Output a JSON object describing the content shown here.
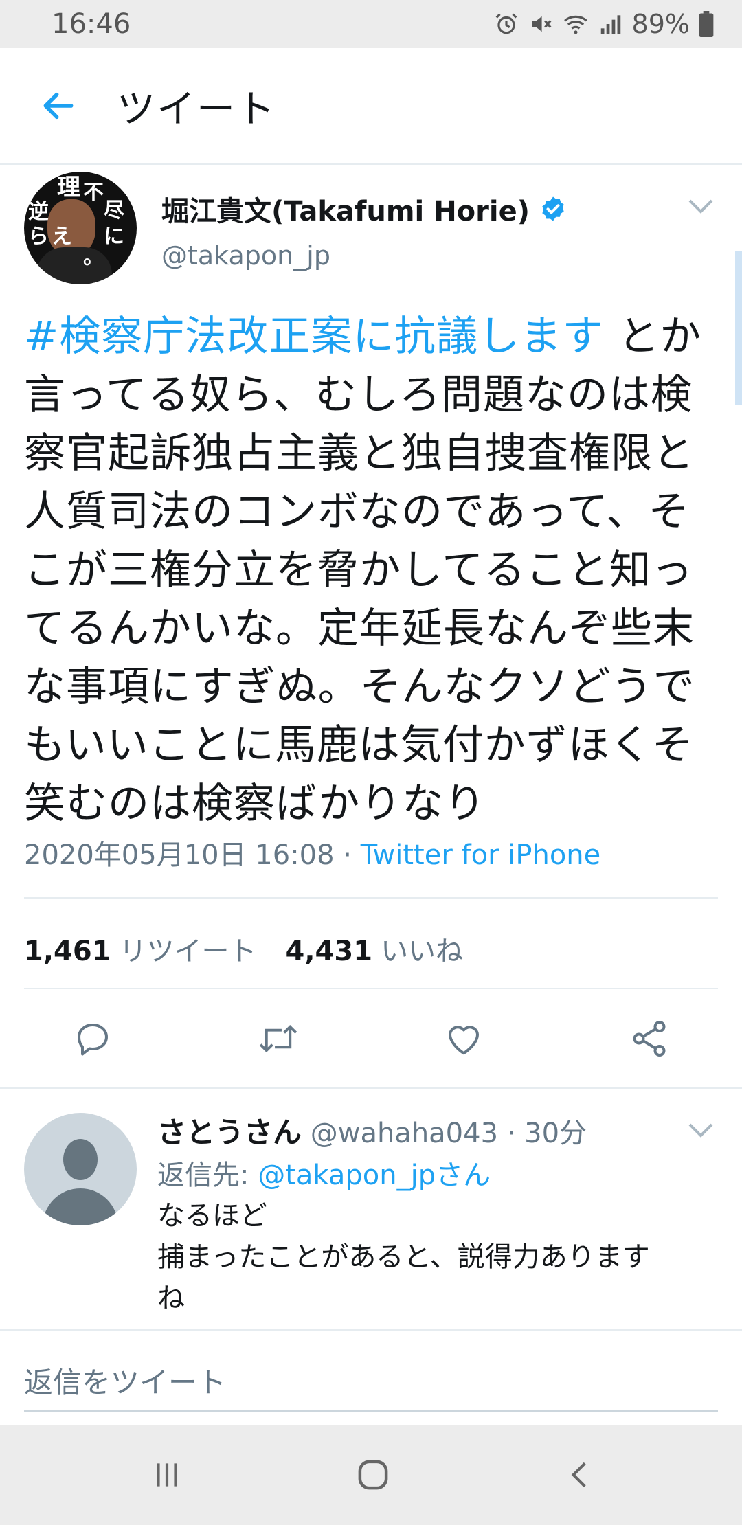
{
  "status_bar": {
    "time": "16:46",
    "battery": "89%",
    "icons": [
      "alarm-icon",
      "mute-icon",
      "wifi-icon",
      "signal-icon",
      "battery-icon"
    ]
  },
  "header": {
    "title": "ツイート",
    "back_icon": "back-arrow-icon"
  },
  "tweet": {
    "author": {
      "name": "堀江貴文(Takafumi Horie)",
      "handle": "@takapon_jp",
      "verified": true,
      "avatar_text": [
        "理",
        "不",
        "尽",
        "に",
        "逆",
        "ら",
        "え",
        "。"
      ]
    },
    "hashtag": "#検察庁法改正案に抗議します",
    "body": " とか言ってる奴ら、むしろ問題なのは検察官起訴独占主義と独自捜査権限と人質司法のコンボなのであって、そこが三権分立を脅かしてること知ってるんかいな。定年延長なんぞ些末な事項にすぎぬ。そんなクソどうでもいいことに馬鹿は気付かずほくそ笑むのは検察ばかりなり",
    "timestamp": "2020年05月10日 16:08 · ",
    "source": "Twitter for iPhone",
    "retweets_count": "1,461",
    "retweets_label": "リツイート",
    "likes_count": "4,431",
    "likes_label": "いいね",
    "actions": [
      "reply-icon",
      "retweet-icon",
      "like-icon",
      "share-icon"
    ]
  },
  "reply": {
    "name": "さとうさん",
    "handle": " @wahaha043 · 30分",
    "reply_to_prefix": "返信先: ",
    "reply_to_mention": "@takapon_jpさん",
    "text_line1": "なるほど",
    "text_line2": "捕まったことがあると、説得力あります",
    "text_line3": "ね"
  },
  "compose": {
    "placeholder": "返信をツイート"
  },
  "nav_bar": {
    "buttons": [
      "recents-icon",
      "home-icon",
      "back-icon"
    ]
  },
  "colors": {
    "accent": "#1da1f2",
    "text": "#14171a",
    "secondary": "#657786",
    "divider": "#e6ecf0"
  }
}
